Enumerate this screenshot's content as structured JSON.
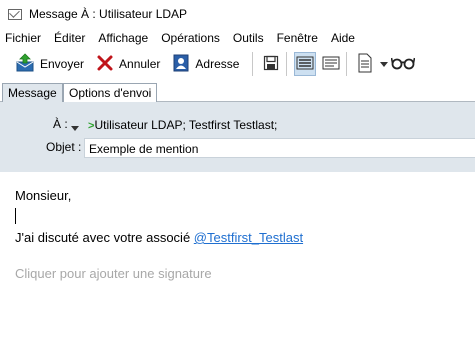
{
  "window": {
    "title": "Message À : Utilisateur LDAP"
  },
  "menu": [
    "Fichier",
    "Éditer",
    "Affichage",
    "Opérations",
    "Outils",
    "Fenêtre",
    "Aide"
  ],
  "toolbar": {
    "send_label": "Envoyer",
    "cancel_label": "Annuler",
    "address_label": "Adresse"
  },
  "tabs": [
    {
      "label": "Message",
      "active": true
    },
    {
      "label": "Options d'envoi",
      "active": false
    }
  ],
  "fields": {
    "to_label": "À :",
    "to_value": "Utilisateur LDAP;  Testfirst Testlast;",
    "subject_label": "Objet :",
    "subject_value": "Exemple de mention"
  },
  "body": {
    "greeting": "Monsieur,",
    "line_prefix": "J'ai discuté avec votre associé ",
    "mention": "@Testfirst_Testlast",
    "signature_placeholder": "Cliquer pour ajouter une signature"
  },
  "colors": {
    "header_bg": "#dfe6ec",
    "mention": "#1f6fd0",
    "arrow": "#2fa12f",
    "cancel_x": "#c0151b"
  }
}
